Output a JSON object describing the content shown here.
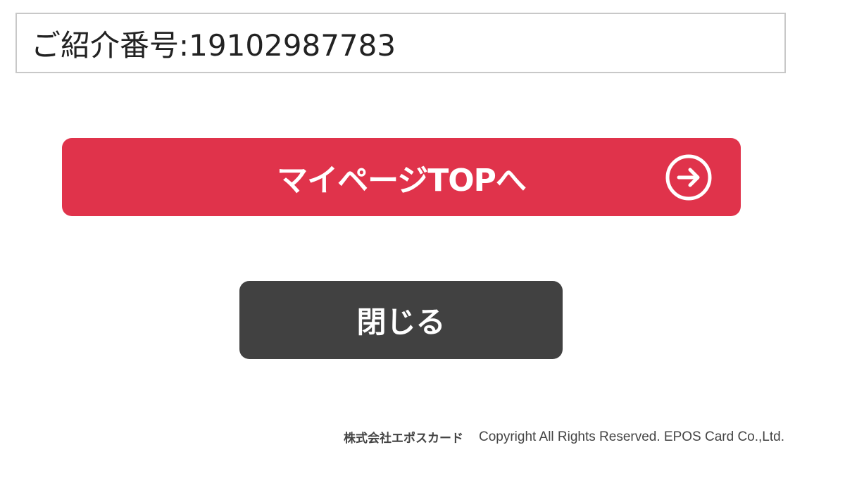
{
  "referral": {
    "text": "ご紹介番号:19102987783"
  },
  "buttons": {
    "mypage_label": "マイページTOPへ",
    "mypage_icon": "arrow-circle-right-icon",
    "close_label": "閉じる"
  },
  "footer": {
    "company": "株式会社エポスカード",
    "copyright": "Copyright All Rights Reserved. EPOS Card Co.,Ltd."
  },
  "colors": {
    "primary_button": "#e0334b",
    "secondary_button": "#414141",
    "border": "#c8c8c8"
  }
}
